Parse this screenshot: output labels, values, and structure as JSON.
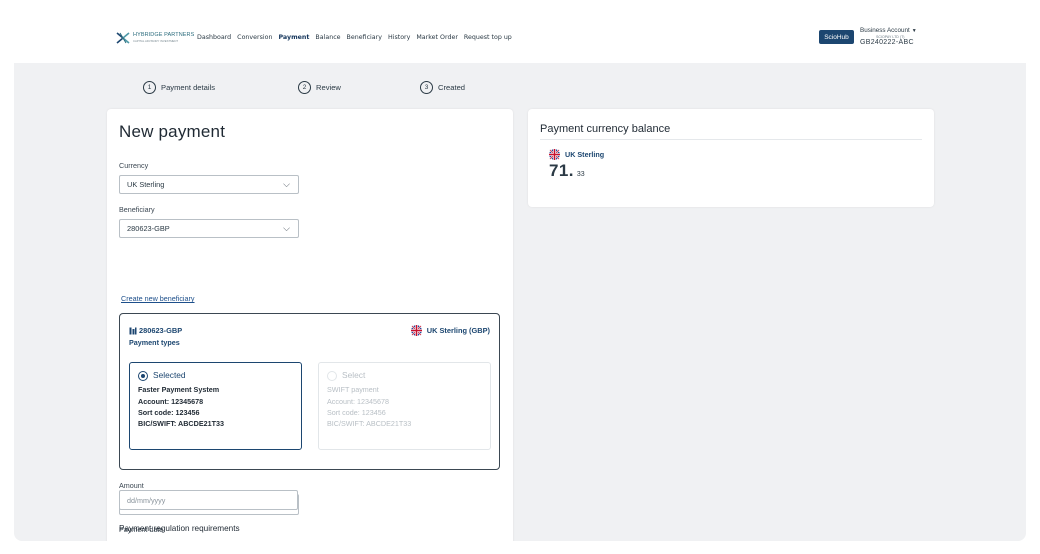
{
  "header": {
    "logo": {
      "name": "HYBRIDGE PARTNERS",
      "tagline": "CAPITAL ADVISORY INVESTMENT"
    },
    "nav": [
      "Dashboard",
      "Conversion",
      "Payment",
      "Balance",
      "Beneficiary",
      "History",
      "Market Order",
      "Request top up"
    ],
    "active_nav": "Payment",
    "brand_badge": "ScioHub",
    "account": {
      "title": "Business Account",
      "company": "SCIOPAY LTD (T)",
      "id": "GB240222-ABC"
    }
  },
  "steps": [
    {
      "number": "1",
      "label": "Payment details"
    },
    {
      "number": "2",
      "label": "Review"
    },
    {
      "number": "3",
      "label": "Created"
    }
  ],
  "form": {
    "title": "New payment",
    "currency_label": "Currency",
    "currency_value": "UK Sterling",
    "beneficiary_label": "Beneficiary",
    "beneficiary_value": "280623-GBP",
    "create_link": "Create new beneficiary",
    "beneficiary_card": {
      "name": "280623-GBP",
      "subtitle": "Payment types",
      "currency": "UK Sterling (GBP)",
      "options": [
        {
          "radio_label": "Selected",
          "name": "Faster Payment System",
          "account": "Account: 12345678",
          "sort": "Sort code: 123456",
          "bic": "BIC/SWIFT: ABCDE21T33",
          "state": "selected"
        },
        {
          "radio_label": "Select",
          "name": "SWIFT payment",
          "account": "Account: 12345678",
          "sort": "Sort code: 123456",
          "bic": "BIC/SWIFT: ABCDE21T33",
          "state": "disabled"
        }
      ]
    },
    "amount_label": "Amount",
    "amount_value": "",
    "date_label": "Payment date",
    "date_placeholder": "dd/mm/yyyy",
    "regulation_title": "Payment regulation requirements"
  },
  "balance": {
    "title": "Payment currency balance",
    "currency": "UK Sterling",
    "amount_integer": "71.",
    "amount_decimal": "33"
  },
  "colors": {
    "accent": "#1c4670",
    "background": "#f0f1f3",
    "link": "#1d4f8b"
  },
  "icons": {
    "flag": "uk-flag-icon",
    "bank": "bank-icon",
    "dropdown": "chevron-down-icon"
  }
}
